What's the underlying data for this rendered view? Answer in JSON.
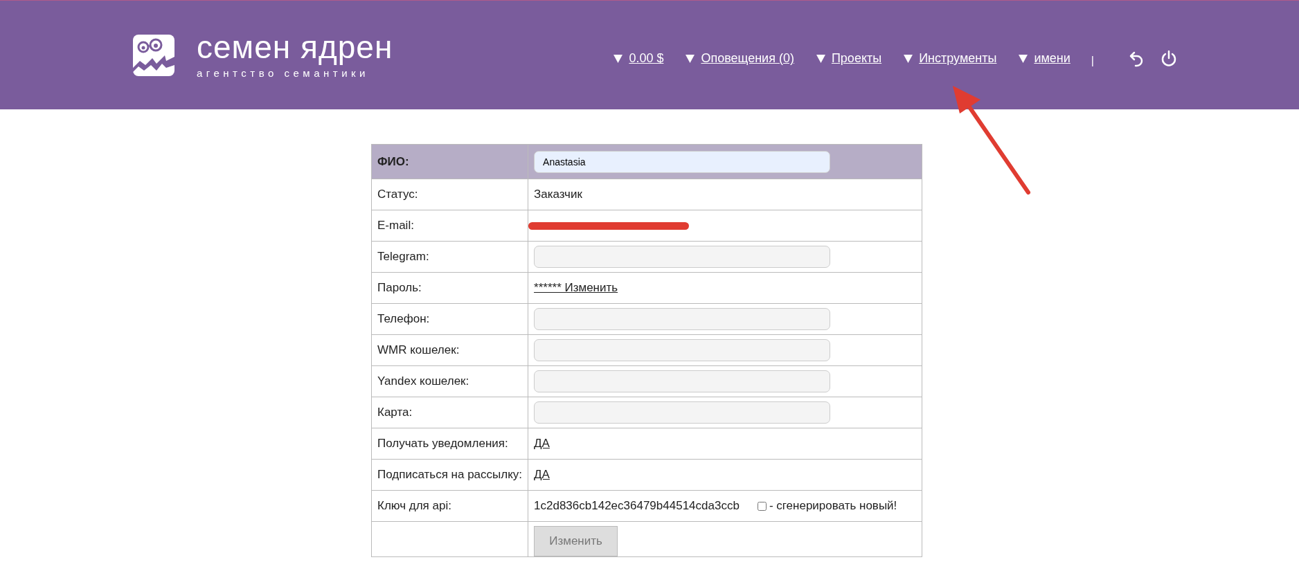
{
  "header": {
    "logo": {
      "title": "семен ядрен",
      "subtitle": "агентство семантики"
    },
    "nav": [
      {
        "label": "0.00 $"
      },
      {
        "label": "Оповещения (0)"
      },
      {
        "label": "Проекты"
      },
      {
        "label": "Инструменты"
      },
      {
        "label": "имени"
      }
    ],
    "separator": "|"
  },
  "profile": {
    "rows": [
      {
        "kind": "header-input",
        "label": "ФИО:",
        "value": "Anastasia"
      },
      {
        "kind": "text",
        "label": "Статус:",
        "value": "Заказчик"
      },
      {
        "kind": "redacted",
        "label": "E-mail:"
      },
      {
        "kind": "input",
        "label": "Telegram:"
      },
      {
        "kind": "link",
        "label": "Пароль:",
        "value": "****** Изменить"
      },
      {
        "kind": "input",
        "label": "Телефон:"
      },
      {
        "kind": "input",
        "label": "WMR кошелек:"
      },
      {
        "kind": "input",
        "label": "Yandex кошелек:"
      },
      {
        "kind": "input",
        "label": "Карта:"
      },
      {
        "kind": "link",
        "label": "Получать уведомления:",
        "value": "ДА"
      },
      {
        "kind": "link",
        "label": "Подписаться на рассылку:",
        "value": "ДА"
      },
      {
        "kind": "api",
        "label": "Ключ для api:",
        "value": "1c2d836cb142ec36479b44514cda3ccb",
        "checked": false,
        "checkbox_label": "- сгенерировать новый!"
      },
      {
        "kind": "button",
        "value": "Изменить"
      }
    ]
  },
  "annotation": {
    "kind": "arrow"
  }
}
